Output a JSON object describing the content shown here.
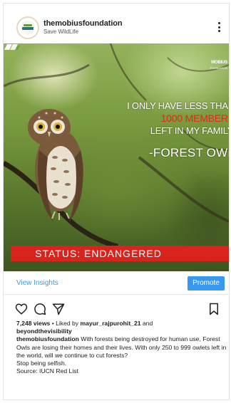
{
  "post": {
    "account_name": "themobiusfoundation",
    "account_subtitle": "Save WildLife"
  },
  "image": {
    "logo_line1": "MOBIUS",
    "logo_line2": "FOUNDATION",
    "quote_line1": "I ONLY HAVE LESS THAN",
    "quote_line2": "1000 MEMBERS",
    "quote_line3": "LEFT IN MY FAMILY.",
    "quote_signature": "-FOREST OWL",
    "status_label": "STATUS: ENDANGERED",
    "colors": {
      "status_red": "#d8241c",
      "highlight_red": "#e8261e"
    }
  },
  "insights": {
    "view_insights_label": "View Insights",
    "promote_label": "Promote",
    "accent": "#3897f0"
  },
  "actions": {
    "icons": [
      "heart-icon",
      "comment-icon",
      "share-icon",
      "bookmark-icon"
    ]
  },
  "caption": {
    "views_count": "7,248 views",
    "liked_by_prefix": " • Liked by ",
    "liked_user_1": "mayur_rajpurohit_21",
    "liked_and": " and",
    "liked_user_2": "beyondthevisibility",
    "caption_user": "themobiusfoundation",
    "caption_body": " With forests being destroyed for human use, Forest Owls are losing their homes and their lives. With only 250 to 999 owlets left in the world, will we continue to cut forests?",
    "line_selfish": "Stop being selfish.",
    "line_source": "Source: IUCN Red List"
  }
}
